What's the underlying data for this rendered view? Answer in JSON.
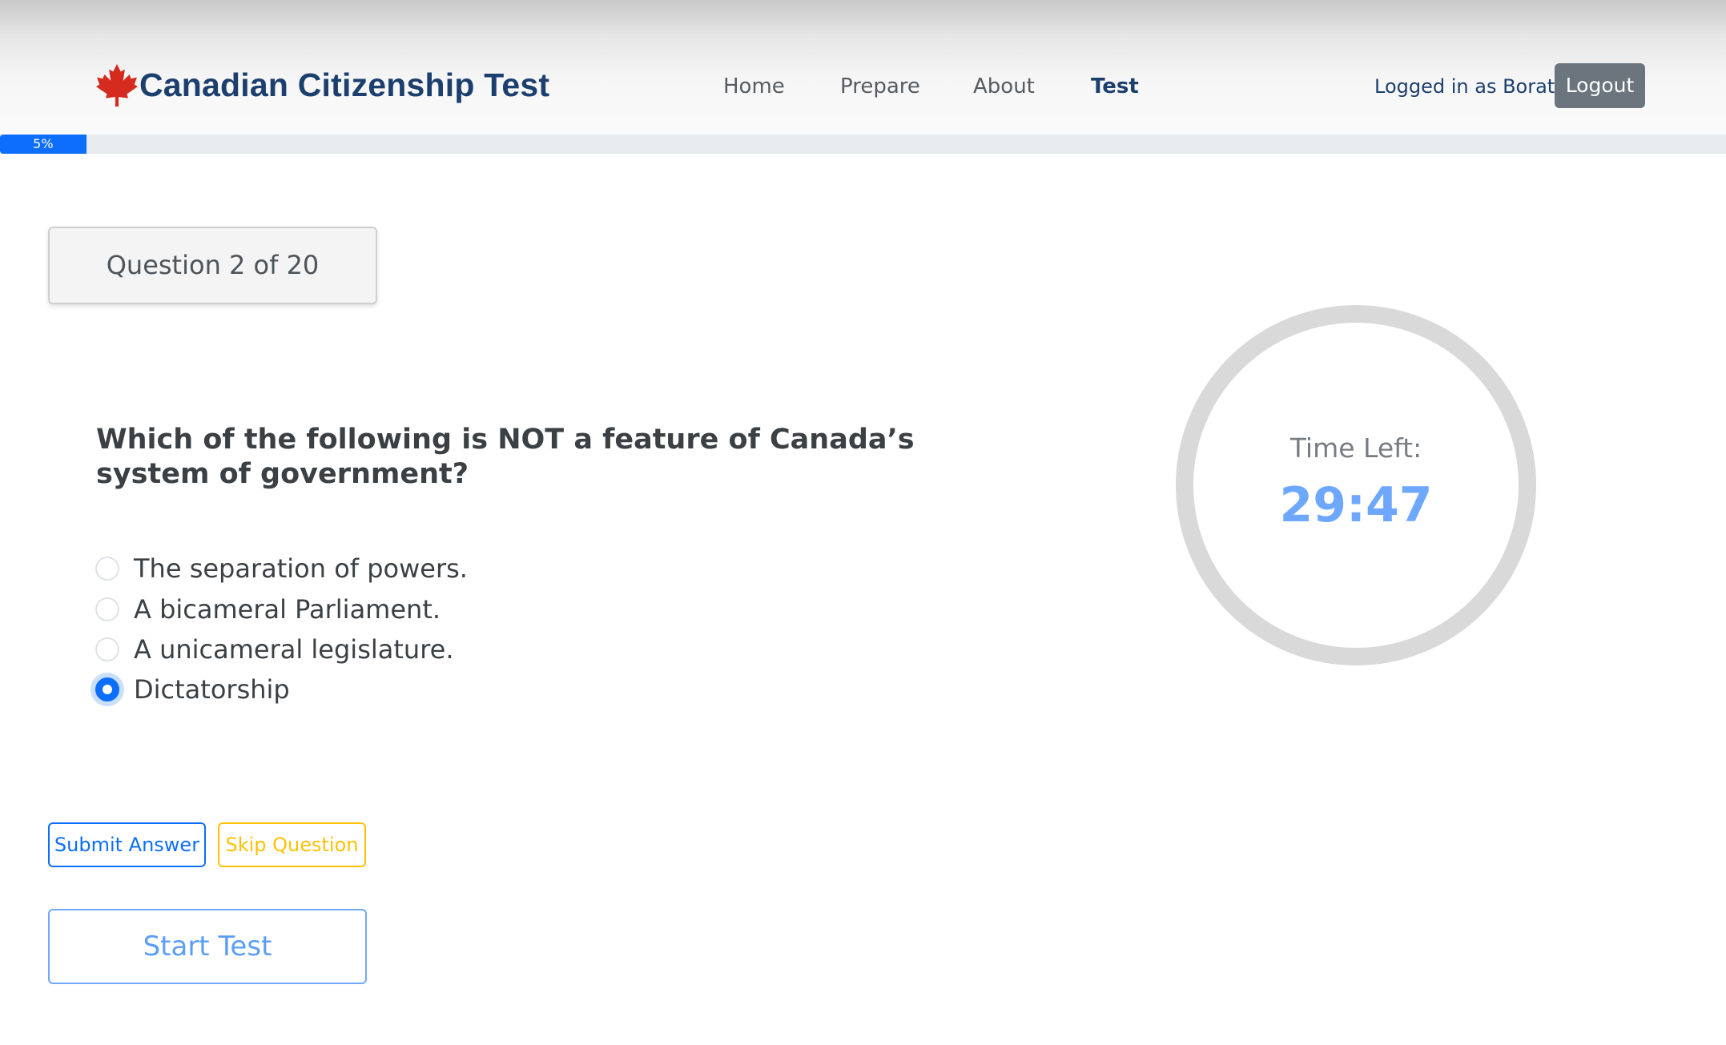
{
  "header": {
    "brand_title": "Canadian Citizenship Test",
    "logo_icon": "maple-leaf-icon",
    "nav": {
      "home": "Home",
      "prepare": "Prepare",
      "about": "About",
      "test": "Test"
    },
    "active_nav": "Test",
    "logged_in_text": "Logged in as Borat",
    "logout_label": "Logout"
  },
  "progress": {
    "label": "5%",
    "value_percent": 5
  },
  "question": {
    "counter": "Question 2 of 20",
    "text": "Which of the following is NOT a feature of Canada’s system of government?",
    "options": [
      {
        "label": "The separation of powers.",
        "checked": false
      },
      {
        "label": "A bicameral Parliament.",
        "checked": false
      },
      {
        "label": "A unicameral legislature.",
        "checked": false
      },
      {
        "label": "Dictatorship",
        "checked": true
      }
    ]
  },
  "actions": {
    "submit_label": "Submit Answer",
    "skip_label": "Skip Question",
    "start_label": "Start Test"
  },
  "timer": {
    "label": "Time Left:",
    "value": "29:47"
  },
  "colors": {
    "brand": "#1c3f6e",
    "primary": "#0d6efd",
    "warning": "#ffc107",
    "secondary": "#6c757d",
    "timer_value": "#6ea8fe",
    "leaf": "#d52b1e"
  }
}
